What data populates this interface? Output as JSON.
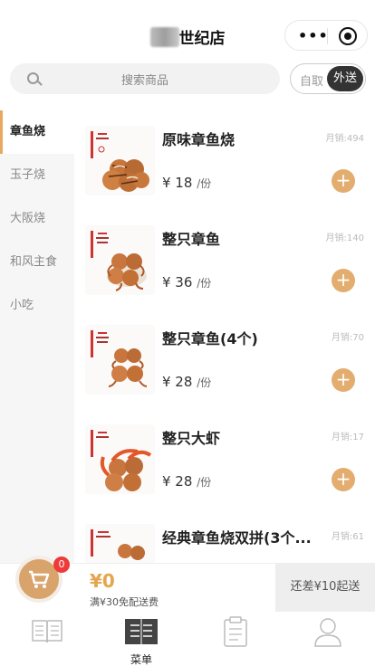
{
  "header": {
    "title": "世纪店",
    "more_icon": "more-dots-icon",
    "close_icon": "target-circle-icon"
  },
  "search": {
    "placeholder": "搜索商品"
  },
  "mode": {
    "pickup": "自取",
    "delivery": "外送",
    "active": "delivery"
  },
  "categories": [
    {
      "label": "章鱼烧",
      "active": true
    },
    {
      "label": "玉子烧",
      "active": false
    },
    {
      "label": "大阪烧",
      "active": false
    },
    {
      "label": "和风主食",
      "active": false
    },
    {
      "label": "小吃",
      "active": false
    }
  ],
  "products": [
    {
      "name": "原味章鱼烧",
      "sold": "月销:494",
      "price": "¥ 18",
      "unit": "/份"
    },
    {
      "name": "整只章鱼",
      "sold": "月销:140",
      "price": "¥ 36",
      "unit": "/份"
    },
    {
      "name": "整只章鱼(4个)",
      "sold": "月销:70",
      "price": "¥ 28",
      "unit": "/份"
    },
    {
      "name": "整只大虾",
      "sold": "月销:17",
      "price": "¥ 28",
      "unit": "/份"
    },
    {
      "name": "经典章鱼烧双拼(3个...",
      "sold": "月销:61",
      "price": "",
      "unit": ""
    }
  ],
  "cart": {
    "badge": "0",
    "total": "¥0",
    "free_delivery": "满¥30免配送费",
    "checkout": "还差¥10起送"
  },
  "tabbar": [
    {
      "label": "",
      "icon": "book-icon",
      "active": false
    },
    {
      "label": "菜单",
      "icon": "menu-icon",
      "active": true
    },
    {
      "label": "",
      "icon": "clipboard-icon",
      "active": false
    },
    {
      "label": "",
      "icon": "user-icon",
      "active": false
    }
  ],
  "colors": {
    "accent": "#e3ad6f",
    "price_accent": "#e5a54e",
    "badge": "#ee3a3a",
    "dark": "#333333"
  }
}
